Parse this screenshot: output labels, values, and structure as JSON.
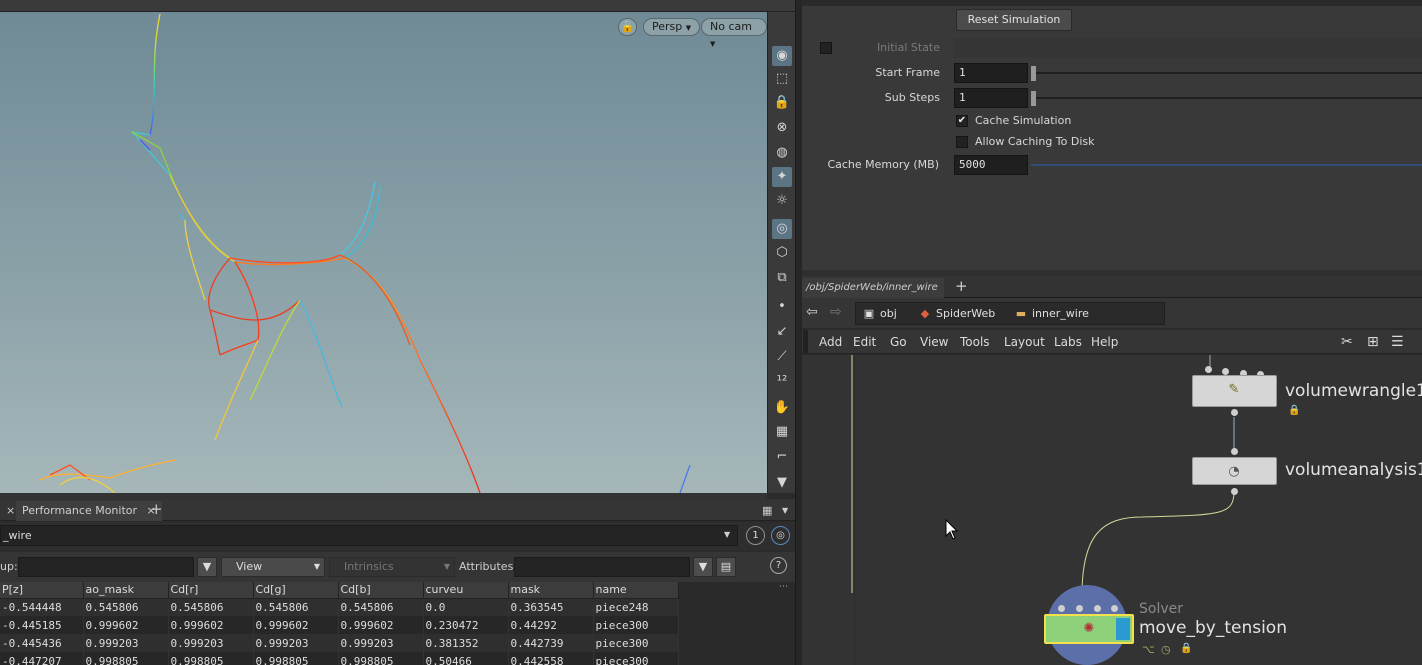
{
  "viewport": {
    "persp_label": "Persp",
    "cam_label": "No cam",
    "toolbar_icons": [
      "eye-icon",
      "select-icon",
      "lock-icon",
      "ghost-icon",
      "sphere-icon",
      "light-icon",
      "bulb-icon",
      "camera-icon",
      "cube-icon",
      "pen-icon",
      "point-icon",
      "brush-icon",
      "picker-icon",
      "number-icon",
      "hand-icon",
      "stamp-icon",
      "ruler-icon",
      "down-arrow-icon"
    ]
  },
  "bottom_left": {
    "tab_label": "Performance Monitor",
    "path_text": "_wire",
    "view_count": "1",
    "group_label": "up:",
    "view_label": "View",
    "intrinsics_label": "Intrinsics",
    "attributes_label": "Attributes:",
    "columns": [
      "P[z]",
      "ao_mask",
      "Cd[r]",
      "Cd[g]",
      "Cd[b]",
      "curveu",
      "mask",
      "name"
    ],
    "rows": [
      [
        "-0.544448",
        "0.545806",
        "0.545806",
        "0.545806",
        "0.545806",
        "0.0",
        "0.363545",
        "piece248"
      ],
      [
        "-0.445185",
        "0.999602",
        "0.999602",
        "0.999602",
        "0.999602",
        "0.230472",
        "0.44292",
        "piece300"
      ],
      [
        "-0.445436",
        "0.999203",
        "0.999203",
        "0.999203",
        "0.999203",
        "0.381352",
        "0.442739",
        "piece300"
      ],
      [
        "-0.447207",
        "0.998805",
        "0.998805",
        "0.998805",
        "0.998805",
        "0.50466",
        "0.442558",
        "piece300"
      ]
    ]
  },
  "params": {
    "reset_label": "Reset Simulation",
    "initial_state_label": "Initial State",
    "start_frame_label": "Start Frame",
    "start_frame_value": "1",
    "sub_steps_label": "Sub Steps",
    "sub_steps_value": "1",
    "cache_sim_label": "Cache Simulation",
    "allow_cache_label": "Allow Caching To Disk",
    "cache_memory_label": "Cache Memory (MB)",
    "cache_memory_value": "5000"
  },
  "network": {
    "tab_path": "/obj/SpiderWeb/inner_wire",
    "crumbs": [
      "obj",
      "SpiderWeb",
      "inner_wire"
    ],
    "menu": [
      "Add",
      "Edit",
      "Go",
      "View",
      "Tools",
      "Layout",
      "Labs",
      "Help"
    ],
    "nodes": {
      "wrangle": "volumewrangle1",
      "analysis": "volumeanalysis1",
      "solver_type": "Solver",
      "solver_name": "move_by_tension"
    }
  },
  "colors": {
    "viewport_top": "#6e8995",
    "node_selected": "#f2e14a",
    "solver_node": "#8fd07a"
  }
}
